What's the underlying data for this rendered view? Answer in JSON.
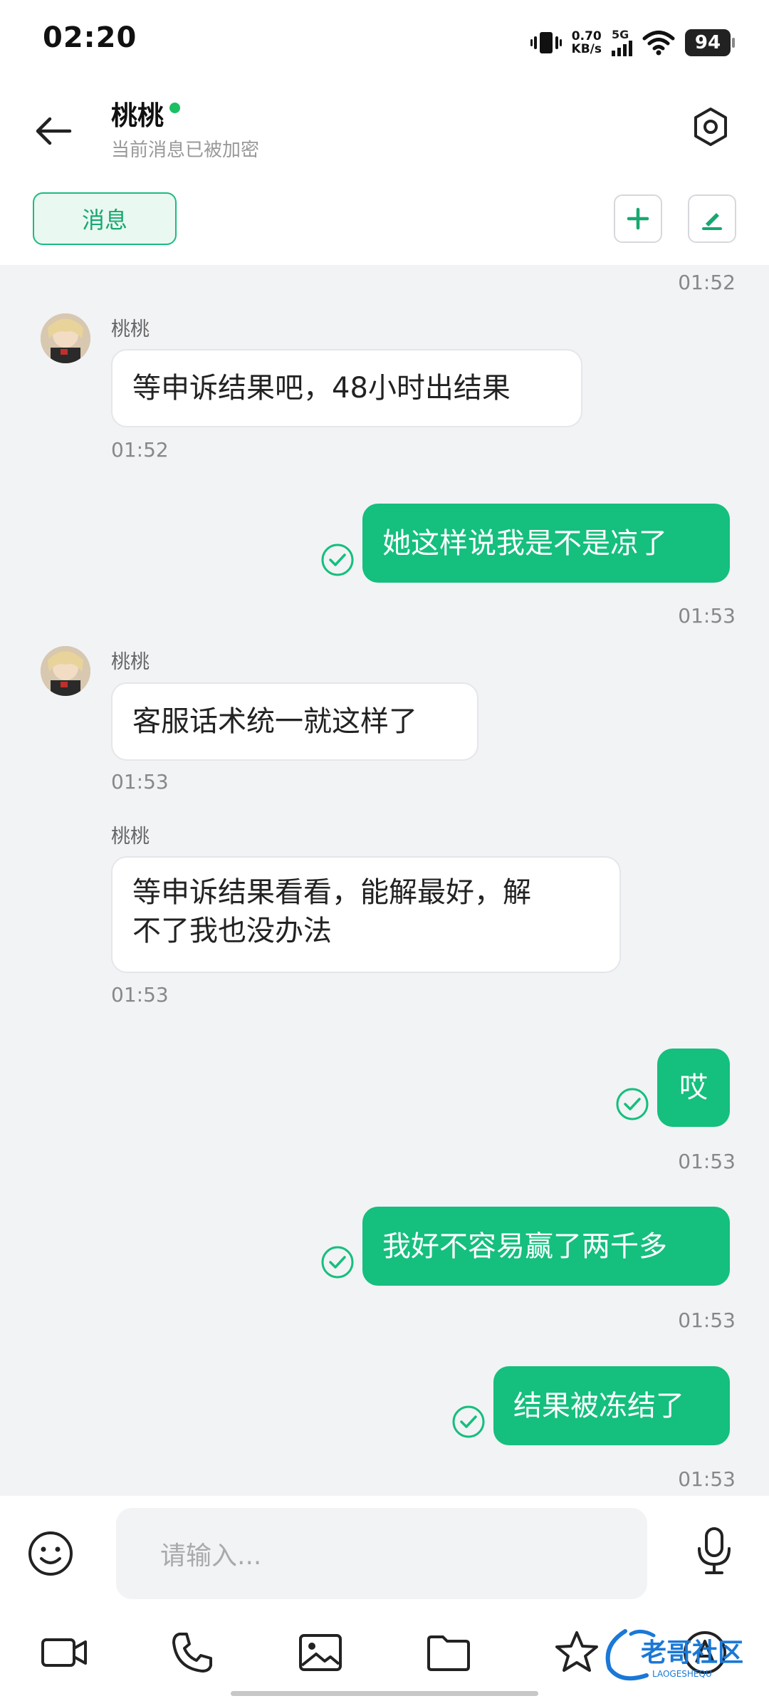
{
  "status_bar": {
    "time": "02:20",
    "net_speed_value": "0.70",
    "net_speed_unit": "KB/s",
    "network": "5G",
    "battery": "94"
  },
  "header": {
    "contact_name": "桃桃",
    "subtitle": "当前消息已被加密",
    "tab_label": "消息",
    "icons": [
      "back-arrow-icon",
      "settings-gear-icon",
      "plus-icon",
      "edit-pen-icon"
    ]
  },
  "chat": {
    "top_time": "01:52",
    "messages": [
      {
        "dir": "in",
        "sender": "桃桃",
        "text": "等申诉结果吧，48小时出结果",
        "time": "01:52"
      },
      {
        "dir": "out",
        "text": "她这样说我是不是凉了",
        "time": "01:53"
      },
      {
        "dir": "in",
        "sender": "桃桃",
        "text": "客服话术统一就这样了",
        "time": "01:53"
      },
      {
        "dir": "in",
        "sender": "桃桃",
        "text_line1": "等申诉结果看看，能解最好，解",
        "text_line2": "不了我也没办法",
        "time": "01:53"
      },
      {
        "dir": "out",
        "text": "哎",
        "time": "01:53"
      },
      {
        "dir": "out",
        "text": "我好不容易赢了两千多",
        "time": "01:53"
      },
      {
        "dir": "out",
        "text": "结果被冻结了",
        "time": "01:53"
      }
    ]
  },
  "input_bar": {
    "placeholder": "请输入..."
  },
  "toolbar": {
    "icons": [
      "video-call-icon",
      "phone-icon",
      "image-icon",
      "folder-icon",
      "star-icon",
      "text-icon"
    ],
    "watermark_text": "老哥社区",
    "watermark_sub": "LAOGESHEQU"
  },
  "colors": {
    "accent_green": "#15bf7e",
    "online_dot": "#1bbf64",
    "chat_bg": "#f2f3f5"
  }
}
